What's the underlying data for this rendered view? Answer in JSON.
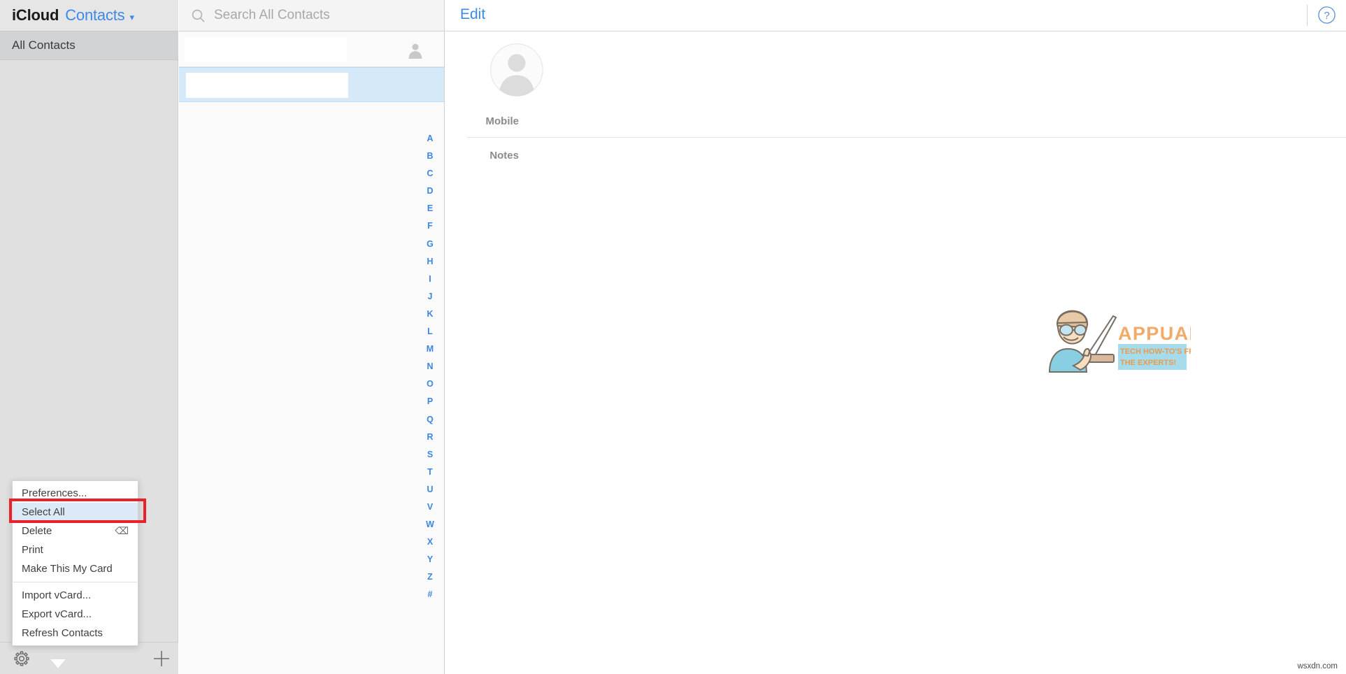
{
  "header": {
    "brand": "iCloud",
    "app_name": "Contacts",
    "chevron_icon": "chevron-down-icon"
  },
  "sidebar": {
    "groups": [
      {
        "label": "All Contacts",
        "selected": true
      }
    ],
    "toolbar": {
      "settings_icon": "gear-icon",
      "add_icon": "plus-icon"
    }
  },
  "search": {
    "placeholder": "Search All Contacts",
    "value": "",
    "icon": "search-icon"
  },
  "contact_list": {
    "rows": [
      {
        "name": "",
        "redacted": true,
        "selected": false,
        "avatar_icon": "person-icon"
      },
      {
        "name": "",
        "redacted": true,
        "selected": true,
        "avatar_icon": "person-icon"
      }
    ],
    "alphabet_index": [
      "A",
      "B",
      "C",
      "D",
      "E",
      "F",
      "G",
      "H",
      "I",
      "J",
      "K",
      "L",
      "M",
      "N",
      "O",
      "P",
      "Q",
      "R",
      "S",
      "T",
      "U",
      "V",
      "W",
      "X",
      "Y",
      "Z",
      "#"
    ]
  },
  "detail": {
    "edit_label": "Edit",
    "help_icon": "question-circle-icon",
    "avatar_icon": "person-placeholder-icon",
    "fields": [
      {
        "label": "Mobile",
        "value": ""
      },
      {
        "label": "Notes",
        "value": ""
      }
    ]
  },
  "context_menu": {
    "items": [
      {
        "label": "Preferences...",
        "shortcut": "",
        "highlighted": false,
        "separator_after": false
      },
      {
        "label": "Select All",
        "shortcut": "",
        "highlighted": true,
        "separator_after": false
      },
      {
        "label": "Delete",
        "shortcut": "⌫",
        "highlighted": false,
        "separator_after": false
      },
      {
        "label": "Print",
        "shortcut": "",
        "highlighted": false,
        "separator_after": false
      },
      {
        "label": "Make This My Card",
        "shortcut": "",
        "highlighted": false,
        "separator_after": true
      },
      {
        "label": "Import vCard...",
        "shortcut": "",
        "highlighted": false,
        "separator_after": false
      },
      {
        "label": "Export vCard...",
        "shortcut": "",
        "highlighted": false,
        "separator_after": false
      },
      {
        "label": "Refresh Contacts",
        "shortcut": "",
        "highlighted": false,
        "separator_after": false
      }
    ]
  },
  "annotation": {
    "color": "#e8212a",
    "target": "Select All"
  },
  "watermarks": {
    "logo_title": "APPUALS",
    "logo_tagline_line1": "TECH HOW-TO'S FROM",
    "logo_tagline_line2": "THE EXPERTS!",
    "site": "wsxdn.com"
  },
  "colors": {
    "accent_blue": "#3b8ae8",
    "index_blue": "#3b86e0",
    "selection_blue": "#d6e9f8",
    "menu_highlight": "#dceaf7",
    "annotation_red": "#e8212a",
    "sidebar_gray": "#e0e0e0"
  }
}
